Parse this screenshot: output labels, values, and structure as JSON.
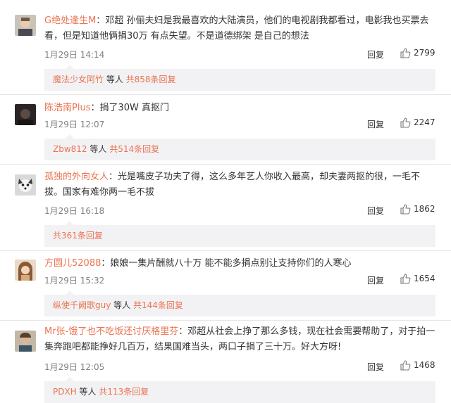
{
  "comments": [
    {
      "user": "G绝处逢生M",
      "sep": "：",
      "text": "邓超 孙俪夫妇是我最喜欢的大陆演员，他们的电视剧我都看过，电影我也买票去看，但是知道他俩捐30万 有点失望。不是道德绑架 是自己的想法",
      "date": "1月29日 14:14",
      "reply": "回复",
      "likes": "2799",
      "sub_user": "魔法少女阿竹",
      "sub_mid": " 等人 ",
      "sub_count": "共858条回复"
    },
    {
      "user": "陈浩南Plus",
      "sep": "：",
      "text": "捐了30W 真抠门",
      "date": "1月29日 12:07",
      "reply": "回复",
      "likes": "2247",
      "sub_user": "Zbw812",
      "sub_mid": " 等人 ",
      "sub_count": "共514条回复"
    },
    {
      "user": "孤独的外向女人",
      "sep": "：",
      "text": "光是嘴皮子功夫了得，这么多年艺人你收入最高，却夫妻两抠的很，一毛不拔。国家有难你两一毛不拔",
      "date": "1月29日 16:18",
      "reply": "回复",
      "likes": "1862",
      "sub_user": "",
      "sub_mid": "",
      "sub_count": "共361条回复"
    },
    {
      "user": "方圆儿52088",
      "sep": "：",
      "text": "娘娘一集片酬就八十万 能不能多捐点别让支持你们的人寒心",
      "date": "1月29日 15:32",
      "reply": "回复",
      "likes": "1654",
      "sub_user": "纵使千阙歌guy",
      "sub_mid": " 等人 ",
      "sub_count": "共144条回复"
    },
    {
      "user": "Mr张-饿了也不吃饭还讨厌格里芬",
      "sep": "：",
      "text": "邓超从社会上挣了那么多钱，现在社会需要帮助了，对于拍一集奔跑吧都能挣好几百万，结果国难当头，两口子捐了三十万。好大方呀!",
      "date": "1月29日 12:05",
      "reply": "回复",
      "likes": "1468",
      "sub_user": "PDXH",
      "sub_mid": " 等人 ",
      "sub_count": "共113条回复"
    }
  ],
  "colors": {
    "accent": "#eb7350",
    "sub_bg": "#f2f2f5",
    "date": "#808080"
  },
  "icons": {
    "like": "thumbs-up-icon"
  }
}
